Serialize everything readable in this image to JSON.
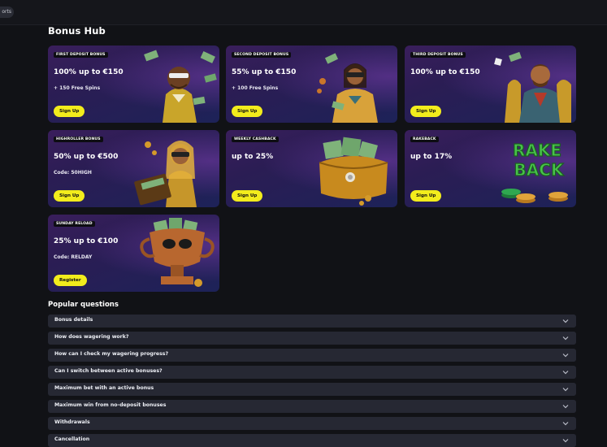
{
  "topbar": {
    "pill_label": "orts"
  },
  "page_title": "Bonus Hub",
  "cards": [
    {
      "badge": "FIRST DEPOSIT BONUS",
      "headline": "100% up to €150",
      "sub": "+ 150 Free Spins",
      "cta": "Sign Up"
    },
    {
      "badge": "SECOND DEPOSIT BONUS",
      "headline": "55% up to €150",
      "sub": "+ 100 Free Spins",
      "cta": "Sign Up"
    },
    {
      "badge": "THIRD DEPOSIT BONUS",
      "headline": "100% up to €150",
      "sub": "",
      "cta": "Sign Up"
    },
    {
      "badge": "HIGHROLLER BONUS",
      "headline": "50% up to €500",
      "sub": "Code: 50HIGH",
      "cta": "Sign Up"
    },
    {
      "badge": "WEEKLY CASHBACK",
      "headline": "up to 25%",
      "sub": "",
      "cta": "Sign Up"
    },
    {
      "badge": "RAKEBACK",
      "headline": "up to 17%",
      "sub": "",
      "cta": "Sign Up"
    },
    {
      "badge": "SUNDAY RELOAD",
      "headline": "25% up to €100",
      "sub": "Code: RELDAY",
      "cta": "Register"
    }
  ],
  "art_text": {
    "rakeback_line1": "RAKE",
    "rakeback_line2": "BACK"
  },
  "faq": {
    "title": "Popular questions",
    "items": [
      "Bonus details",
      "How does wagering work?",
      "How can I check my wagering progress?",
      "Can I switch between active bonuses?",
      "Maximum bet with an active bonus",
      "Maximum win from no-deposit bonuses",
      "Withdrawals",
      "Cancellation"
    ]
  },
  "colors": {
    "cta": "#f2ec1c",
    "page_bg": "#111216",
    "faq_row": "#262833"
  }
}
